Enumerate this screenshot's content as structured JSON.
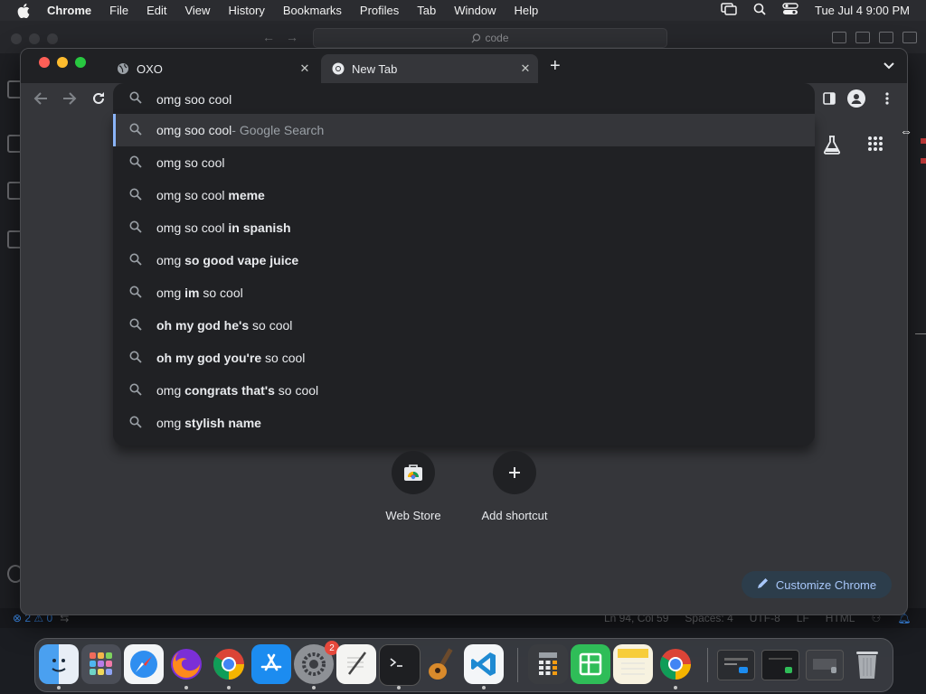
{
  "menubar": {
    "app_name": "Chrome",
    "items": [
      "File",
      "Edit",
      "View",
      "History",
      "Bookmarks",
      "Profiles",
      "Tab",
      "Window",
      "Help"
    ],
    "clock": "Tue Jul 4  9:00 PM",
    "icons": [
      "apple-icon",
      "screen-mirroring-icon",
      "spotlight-icon",
      "control-center-icon"
    ]
  },
  "vscode": {
    "command_center": "code",
    "status": {
      "problems": "2",
      "warnings": "0",
      "position": "Ln 94, Col 59",
      "spaces": "Spaces: 4",
      "encoding": "UTF-8",
      "eol": "LF",
      "language": "HTML"
    }
  },
  "chrome": {
    "tabs": [
      {
        "title": "OXO",
        "active": false
      },
      {
        "title": "New Tab",
        "active": true
      }
    ],
    "omnibox_value": "omg soo cool",
    "suggestions": [
      {
        "prefix": "omg soo cool",
        "bold": "",
        "suffix": " - Google Search",
        "selected": true
      },
      {
        "prefix": "omg so cool",
        "bold": "",
        "suffix": "",
        "selected": false
      },
      {
        "prefix": "omg so cool ",
        "bold": "meme",
        "suffix": "",
        "selected": false
      },
      {
        "prefix": "omg so cool ",
        "bold": "in spanish",
        "suffix": "",
        "selected": false
      },
      {
        "prefix": "omg ",
        "bold": "so good vape juice",
        "suffix": "",
        "selected": false
      },
      {
        "prefix": "omg ",
        "bold": "im",
        "suffix": " so cool",
        "selected": false
      },
      {
        "prefix": "",
        "bold": "oh my god he's",
        "suffix": " so cool",
        "selected": false
      },
      {
        "prefix": "",
        "bold": "oh my god you're",
        "suffix": " so cool",
        "selected": false
      },
      {
        "prefix": "omg ",
        "bold": "congrats that's",
        "suffix": " so cool",
        "selected": false
      },
      {
        "prefix": "omg ",
        "bold": "stylish name",
        "suffix": "",
        "selected": false
      }
    ],
    "shortcuts": [
      {
        "label": "Web Store",
        "icon": "web-store-icon"
      },
      {
        "label": "Add shortcut",
        "icon": "plus-icon"
      }
    ],
    "customize_label": "Customize Chrome"
  },
  "dock": {
    "apps": [
      "Finder",
      "Launchpad",
      "Safari",
      "Firefox",
      "Google Chrome",
      "App Store",
      "System Settings",
      "TextEdit",
      "Terminal",
      "GarageBand",
      "Visual Studio Code",
      "Calculator",
      "Numbers",
      "Notes",
      "Google Chrome Beta"
    ],
    "settings_badge": "2"
  }
}
